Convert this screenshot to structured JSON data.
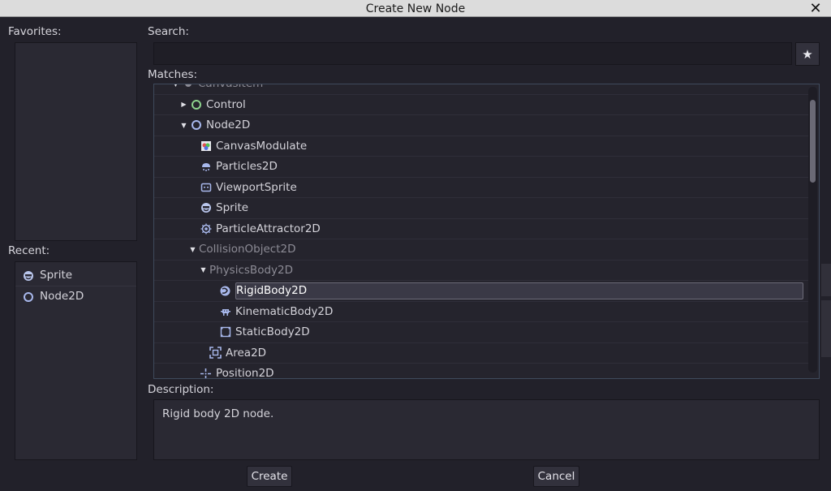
{
  "window": {
    "title": "Create New Node",
    "close_symbol": "✕"
  },
  "favorites": {
    "label": "Favorites:"
  },
  "recent": {
    "label": "Recent:",
    "items": [
      {
        "label": "Sprite",
        "icon": "sprite-icon"
      },
      {
        "label": "Node2D",
        "icon": "node2d-icon"
      }
    ]
  },
  "search": {
    "label": "Search:",
    "value": "",
    "placeholder": "",
    "favorite_symbol": "★"
  },
  "matches": {
    "label": "Matches:",
    "rows": [
      {
        "label": "CanvasItem",
        "icon": "canvasitem-icon",
        "expanded": true,
        "dim": true
      },
      {
        "label": "Control",
        "icon": "control-icon",
        "expanded": false
      },
      {
        "label": "Node2D",
        "icon": "node2d-icon",
        "expanded": true
      },
      {
        "label": "CanvasModulate",
        "icon": "canvasmodulate-icon"
      },
      {
        "label": "Particles2D",
        "icon": "particles2d-icon"
      },
      {
        "label": "ViewportSprite",
        "icon": "viewportsprite-icon"
      },
      {
        "label": "Sprite",
        "icon": "sprite-icon"
      },
      {
        "label": "ParticleAttractor2D",
        "icon": "particleattractor2d-icon"
      },
      {
        "label": "CollisionObject2D",
        "icon": "",
        "expanded": true,
        "dim": true
      },
      {
        "label": "PhysicsBody2D",
        "icon": "",
        "expanded": true,
        "dim": true
      },
      {
        "label": "RigidBody2D",
        "icon": "rigidbody2d-icon",
        "selected": true
      },
      {
        "label": "KinematicBody2D",
        "icon": "kinematicbody2d-icon"
      },
      {
        "label": "StaticBody2D",
        "icon": "staticbody2d-icon"
      },
      {
        "label": "Area2D",
        "icon": "area2d-icon"
      },
      {
        "label": "Position2D",
        "icon": "position2d-icon"
      }
    ]
  },
  "description": {
    "label": "Description:",
    "text": "Rigid body 2D node."
  },
  "buttons": {
    "create": "Create",
    "cancel": "Cancel"
  },
  "colors": {
    "background": "#22212a",
    "panel": "#2a2933",
    "accent": "#8fa4d8",
    "control_green": "#8dd38d"
  }
}
